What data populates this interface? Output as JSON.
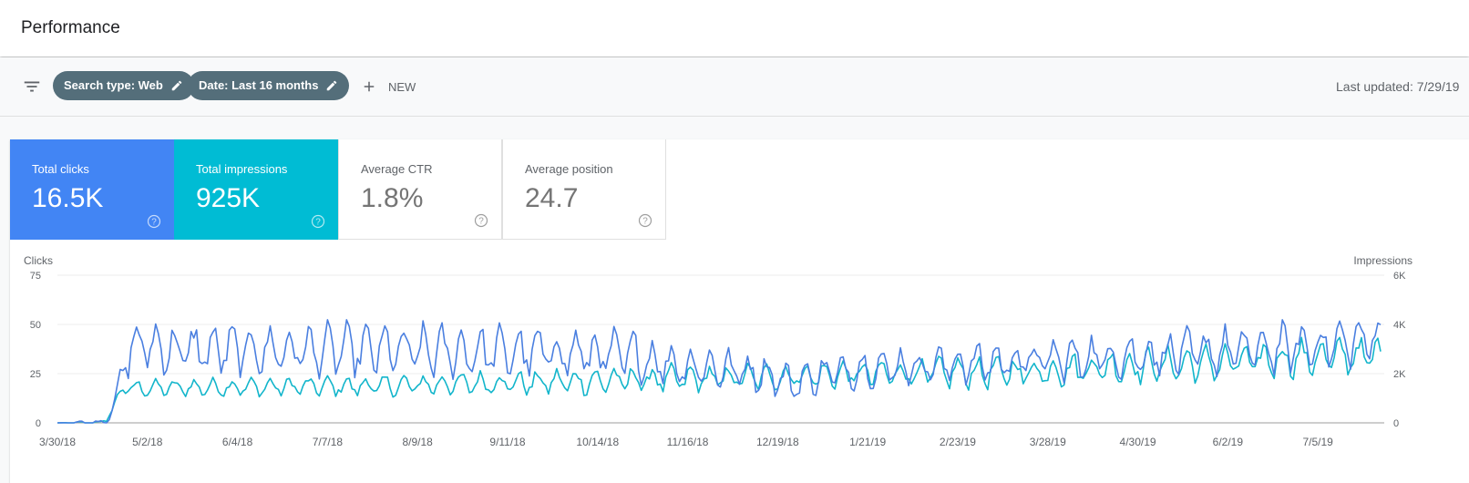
{
  "header": {
    "title": "Performance"
  },
  "toolbar": {
    "filter_icon": "filter-list-icon",
    "chips": [
      {
        "label": "Search type: Web",
        "icon": "edit-pencil-icon"
      },
      {
        "label": "Date: Last 16 months",
        "icon": "edit-pencil-icon"
      }
    ],
    "new_label": "NEW",
    "new_icon": "plus-icon",
    "last_updated": "Last updated: 7/29/19"
  },
  "metrics": [
    {
      "label": "Total clicks",
      "value": "16.5K",
      "selected": true,
      "color": "#4285f4",
      "icon": "help-circle-icon"
    },
    {
      "label": "Total impressions",
      "value": "925K",
      "selected": true,
      "color": "#00bcd4",
      "icon": "help-circle-icon"
    },
    {
      "label": "Average CTR",
      "value": "1.8%",
      "selected": false,
      "icon": "help-circle-icon"
    },
    {
      "label": "Average position",
      "value": "24.7",
      "selected": false,
      "icon": "help-circle-icon"
    }
  ],
  "chart_data": {
    "type": "line",
    "x_start": "2018-03-30",
    "x_end": "2019-07-28",
    "xlabels": [
      "3/30/18",
      "5/2/18",
      "6/4/18",
      "7/7/18",
      "8/9/18",
      "9/11/18",
      "10/14/18",
      "11/16/18",
      "12/19/18",
      "1/21/19",
      "2/23/19",
      "3/28/19",
      "4/30/19",
      "6/2/19",
      "7/5/19"
    ],
    "left_axis": {
      "label": "Clicks",
      "range": [
        0,
        75
      ],
      "ticks": [
        "0",
        "25",
        "50",
        "75"
      ]
    },
    "right_axis": {
      "label": "Impressions",
      "range": [
        0,
        6000
      ],
      "ticks": [
        "0",
        "2K",
        "4K",
        "6K"
      ]
    },
    "grid": true,
    "series": [
      {
        "name": "Clicks",
        "axis": "left",
        "color": "#4a7fe0",
        "anchors": [
          [
            0,
            0
          ],
          [
            15,
            0
          ],
          [
            18,
            1
          ],
          [
            21,
            10
          ],
          [
            24,
            28
          ],
          [
            27,
            38
          ],
          [
            30,
            40
          ],
          [
            45,
            37
          ],
          [
            60,
            37
          ],
          [
            90,
            37
          ],
          [
            120,
            37
          ],
          [
            150,
            36
          ],
          [
            180,
            36
          ],
          [
            210,
            34
          ],
          [
            225,
            30
          ],
          [
            240,
            28
          ],
          [
            260,
            25
          ],
          [
            270,
            20
          ],
          [
            280,
            25
          ],
          [
            300,
            28
          ],
          [
            330,
            30
          ],
          [
            360,
            32
          ],
          [
            390,
            34
          ],
          [
            420,
            36
          ],
          [
            450,
            38
          ],
          [
            480,
            42
          ],
          [
            486,
            45
          ]
        ],
        "amp": [
          [
            0,
            0
          ],
          [
            21,
            2
          ],
          [
            27,
            10
          ],
          [
            210,
            10
          ],
          [
            240,
            8
          ],
          [
            280,
            7
          ],
          [
            330,
            8
          ],
          [
            486,
            10
          ]
        ]
      },
      {
        "name": "Impressions",
        "axis": "right",
        "color": "#12b5cb",
        "anchors": [
          [
            0,
            0
          ],
          [
            15,
            0
          ],
          [
            18,
            100
          ],
          [
            21,
            800
          ],
          [
            24,
            1400
          ],
          [
            27,
            1400
          ],
          [
            60,
            1450
          ],
          [
            120,
            1500
          ],
          [
            150,
            1600
          ],
          [
            180,
            1650
          ],
          [
            210,
            1750
          ],
          [
            240,
            1800
          ],
          [
            270,
            1900
          ],
          [
            300,
            2000
          ],
          [
            330,
            2050
          ],
          [
            360,
            2100
          ],
          [
            390,
            2300
          ],
          [
            420,
            2400
          ],
          [
            450,
            2600
          ],
          [
            486,
            2800
          ]
        ],
        "amp": [
          [
            0,
            0
          ],
          [
            21,
            100
          ],
          [
            27,
            250
          ],
          [
            150,
            350
          ],
          [
            210,
            450
          ],
          [
            270,
            400
          ],
          [
            330,
            500
          ],
          [
            390,
            550
          ],
          [
            486,
            600
          ]
        ]
      }
    ]
  }
}
